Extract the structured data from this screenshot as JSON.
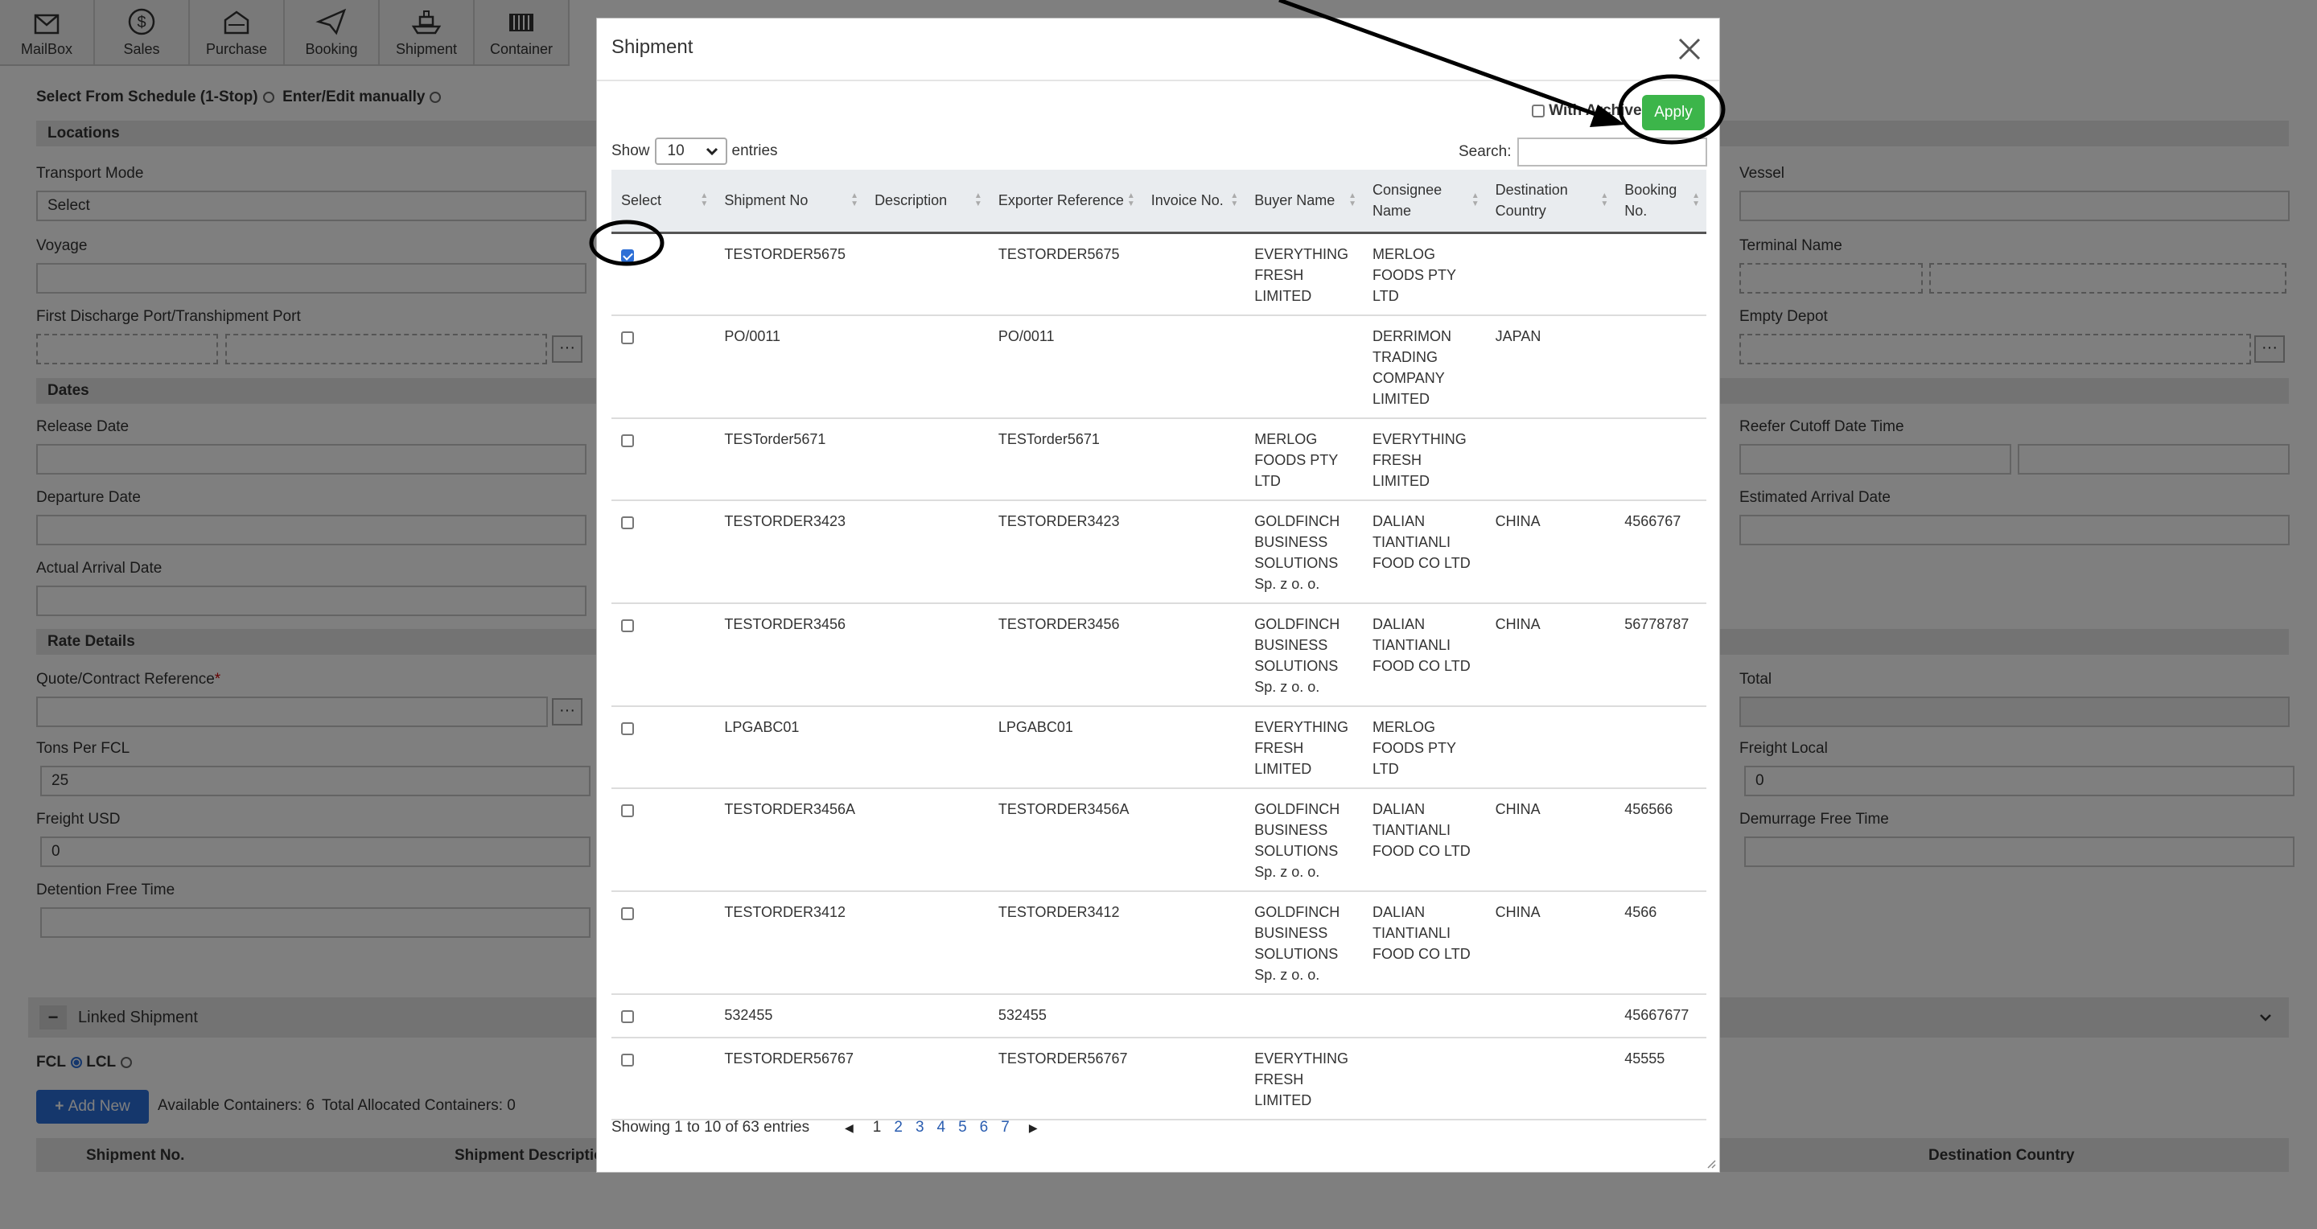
{
  "toolbar": {
    "items": [
      {
        "label": "MailBox",
        "icon": "mailbox-icon"
      },
      {
        "label": "Sales",
        "icon": "dollar-icon"
      },
      {
        "label": "Purchase",
        "icon": "purchase-icon"
      },
      {
        "label": "Booking",
        "icon": "paper-plane-icon"
      },
      {
        "label": "Shipment",
        "icon": "ship-icon"
      },
      {
        "label": "Container",
        "icon": "container-icon"
      }
    ]
  },
  "background": {
    "select_from_schedule": "Select From Schedule (1-Stop)",
    "enter_edit_manually": "Enter/Edit manually",
    "locations": "Locations",
    "transport_mode": "Transport Mode",
    "transport_mode_value": "Select",
    "voyage": "Voyage",
    "first_discharge": "First Discharge Port/Transhipment Port",
    "dates": "Dates",
    "release_date": "Release Date",
    "departure_date": "Departure Date",
    "actual_arrival_date": "Actual Arrival Date",
    "rate_details": "Rate Details",
    "quote_ref": "Quote/Contract Reference",
    "required_mark": "*",
    "tons_per_fcl": "Tons Per FCL",
    "tons_value": "25",
    "freight_usd": "Freight USD",
    "freight_usd_value": "0",
    "detention_free_time": "Detention Free Time",
    "vessel": "Vessel",
    "terminal_name": "Terminal Name",
    "empty_depot": "Empty Depot",
    "reefer_cutoff": "Reefer Cutoff Date Time",
    "estimated_arrival": "Estimated Arrival Date",
    "total": "Total",
    "freight_local": "Freight Local",
    "freight_local_value": "0",
    "demurrage_free_time": "Demurrage Free Time",
    "linked_shipment": "Linked Shipment",
    "fcl": "FCL",
    "lcl": "LCL",
    "add_new": "Add New",
    "available_containers": "Available Containers: 6",
    "total_allocated": "Total Allocated Containers: 0",
    "col_shipment_no": "Shipment No.",
    "col_shipment_desc": "Shipment Description",
    "col_destination_country": "Destination Country",
    "collapse_symbol": "−",
    "dots": "···"
  },
  "modal": {
    "title": "Shipment",
    "with_archive": "With Archive",
    "apply": "Apply",
    "show": "Show",
    "entries_value": "10",
    "entries": "entries",
    "search": "Search:",
    "columns": [
      "Select",
      "Shipment No",
      "Description",
      "Exporter Reference",
      "Invoice No.",
      "Buyer Name",
      "Consignee Name",
      "Destination Country",
      "Booking No."
    ],
    "rows": [
      {
        "checked": true,
        "shipment_no": "TESTORDER5675",
        "description": "",
        "exporter_ref": "TESTORDER5675",
        "invoice_no": "",
        "buyer": "EVERYTHING FRESH LIMITED",
        "consignee": "MERLOG FOODS PTY LTD",
        "destination": "",
        "booking": ""
      },
      {
        "checked": false,
        "shipment_no": "PO/0011",
        "description": "",
        "exporter_ref": "PO/0011",
        "invoice_no": "",
        "buyer": "",
        "consignee": "DERRIMON TRADING COMPANY LIMITED",
        "destination": "JAPAN",
        "booking": ""
      },
      {
        "checked": false,
        "shipment_no": "TESTorder5671",
        "description": "",
        "exporter_ref": "TESTorder5671",
        "invoice_no": "",
        "buyer": "MERLOG FOODS PTY LTD",
        "consignee": "EVERYTHING FRESH LIMITED",
        "destination": "",
        "booking": ""
      },
      {
        "checked": false,
        "shipment_no": "TESTORDER3423",
        "description": "",
        "exporter_ref": "TESTORDER3423",
        "invoice_no": "",
        "buyer": "GOLDFINCH BUSINESS SOLUTIONS Sp. z o. o.",
        "consignee": "DALIAN TIANTIANLI FOOD CO LTD",
        "destination": "CHINA",
        "booking": "4566767"
      },
      {
        "checked": false,
        "shipment_no": "TESTORDER3456",
        "description": "",
        "exporter_ref": "TESTORDER3456",
        "invoice_no": "",
        "buyer": "GOLDFINCH BUSINESS SOLUTIONS Sp. z o. o.",
        "consignee": "DALIAN TIANTIANLI FOOD CO LTD",
        "destination": "CHINA",
        "booking": "56778787"
      },
      {
        "checked": false,
        "shipment_no": "LPGABC01",
        "description": "",
        "exporter_ref": "LPGABC01",
        "invoice_no": "",
        "buyer": "EVERYTHING FRESH LIMITED",
        "consignee": "MERLOG FOODS PTY LTD",
        "destination": "",
        "booking": ""
      },
      {
        "checked": false,
        "shipment_no": "TESTORDER3456A",
        "description": "",
        "exporter_ref": "TESTORDER3456A",
        "invoice_no": "",
        "buyer": "GOLDFINCH BUSINESS SOLUTIONS Sp. z o. o.",
        "consignee": "DALIAN TIANTIANLI FOOD CO LTD",
        "destination": "CHINA",
        "booking": "456566"
      },
      {
        "checked": false,
        "shipment_no": "TESTORDER3412",
        "description": "",
        "exporter_ref": "TESTORDER3412",
        "invoice_no": "",
        "buyer": "GOLDFINCH BUSINESS SOLUTIONS Sp. z o. o.",
        "consignee": "DALIAN TIANTIANLI FOOD CO LTD",
        "destination": "CHINA",
        "booking": "4566"
      },
      {
        "checked": false,
        "shipment_no": "532455",
        "description": "",
        "exporter_ref": "532455",
        "invoice_no": "",
        "buyer": "",
        "consignee": "",
        "destination": "",
        "booking": "45667677"
      },
      {
        "checked": false,
        "shipment_no": "TESTORDER56767",
        "description": "",
        "exporter_ref": "TESTORDER56767",
        "invoice_no": "",
        "buyer": "EVERYTHING FRESH LIMITED",
        "consignee": "",
        "destination": "",
        "booking": "45555"
      }
    ],
    "showing": "Showing 1 to 10 of 63 entries",
    "pages": [
      "1",
      "2",
      "3",
      "4",
      "5",
      "6",
      "7"
    ],
    "current_page": "1"
  },
  "colors": {
    "apply_green": "#3cb54a",
    "link_blue": "#2a5db0",
    "checkbox_blue": "#2d6fd6",
    "add_new_blue": "#2b6ed8"
  }
}
